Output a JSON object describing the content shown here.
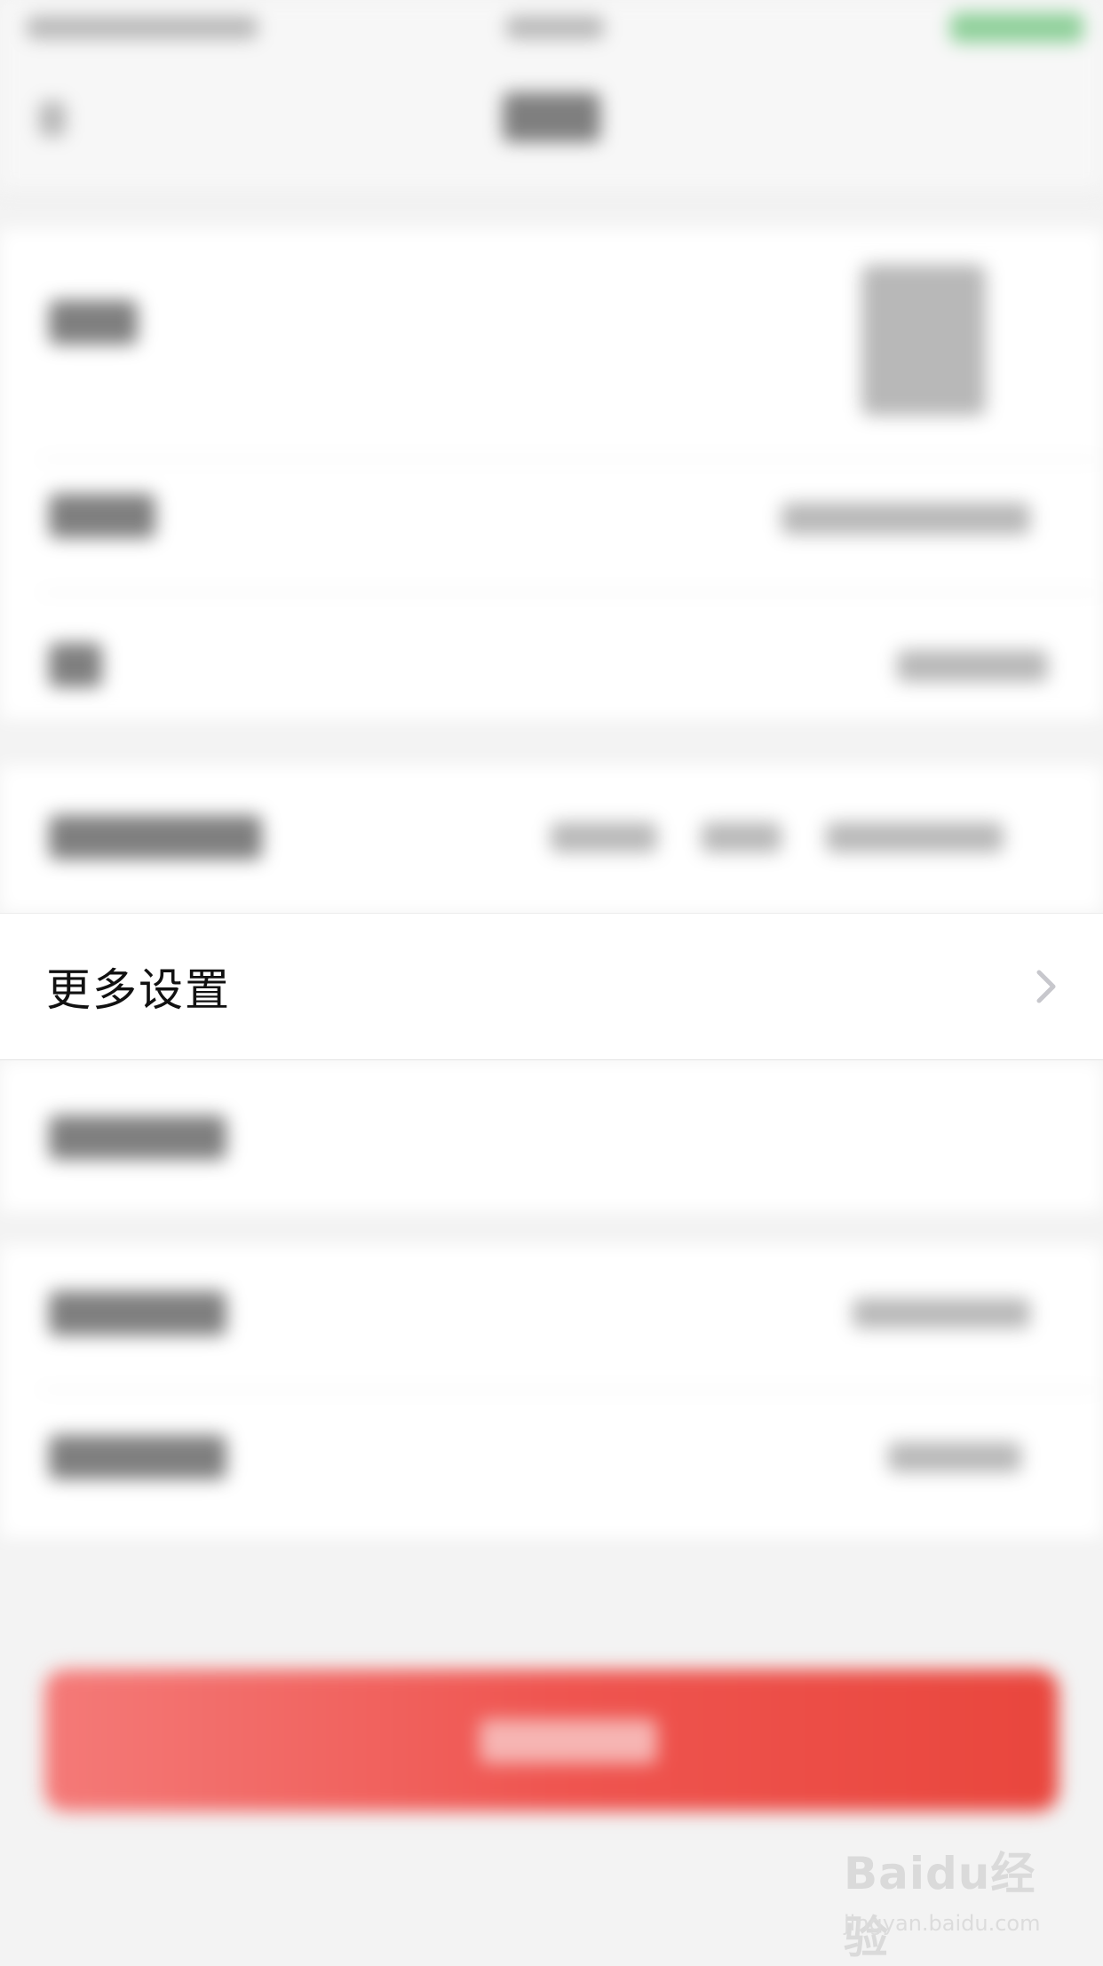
{
  "focused_row": {
    "label": "更多设置",
    "icon": "chevron-right-icon"
  },
  "watermark": {
    "brand_text": "Baidu经验",
    "url_text": "jingyan.baidu.com"
  },
  "colors": {
    "background": "#f3f3f3",
    "row_background": "#ffffff",
    "danger_button": "#ee5550",
    "chevron": "#c7c7cc"
  }
}
